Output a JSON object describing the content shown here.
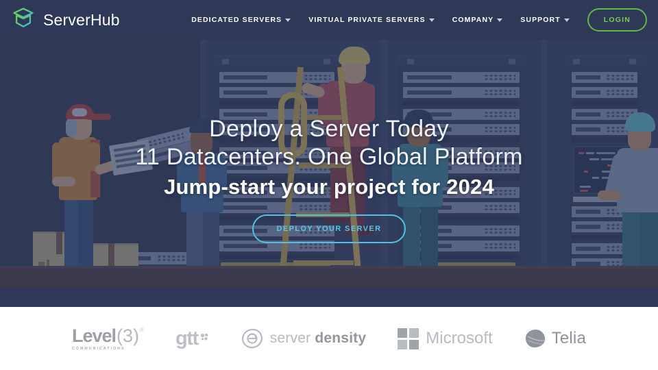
{
  "brand": {
    "name": "ServerHub",
    "logo_icon": "stacked-layers-icon",
    "logo_gradient_start": "#7ac943",
    "logo_gradient_end": "#35c0e0"
  },
  "nav": {
    "items": [
      {
        "label": "DEDICATED SERVERS",
        "has_caret": true
      },
      {
        "label": "VIRTUAL PRIVATE SERVERS",
        "has_caret": true
      },
      {
        "label": "COMPANY",
        "has_caret": true
      },
      {
        "label": "SUPPORT",
        "has_caret": true
      }
    ],
    "login_label": "LOGIN",
    "login_color": "#7ccb4e",
    "background": "#2f3856"
  },
  "hero": {
    "line1": "Deploy a Server Today",
    "line2": "11 Datacenters. One Global Platform",
    "line3": "Jump-start your project for 2024",
    "cta_label": "DEPLOY YOUR SERVER",
    "cta_color": "#55c8e6",
    "illustration": "datacenter-technicians-server-racks"
  },
  "partners": {
    "logos": [
      {
        "name": "level3-logo",
        "word": "Level",
        "paren": "(3)",
        "registered": "®",
        "sub": "COMMUNICATIONS"
      },
      {
        "name": "gtt-logo",
        "word": "gtt"
      },
      {
        "name": "server-density-logo",
        "word_light": "server ",
        "word_bold": "density"
      },
      {
        "name": "microsoft-logo",
        "word": "Microsoft"
      },
      {
        "name": "telia-logo",
        "word": "Telia"
      }
    ],
    "background": "#ffffff"
  }
}
